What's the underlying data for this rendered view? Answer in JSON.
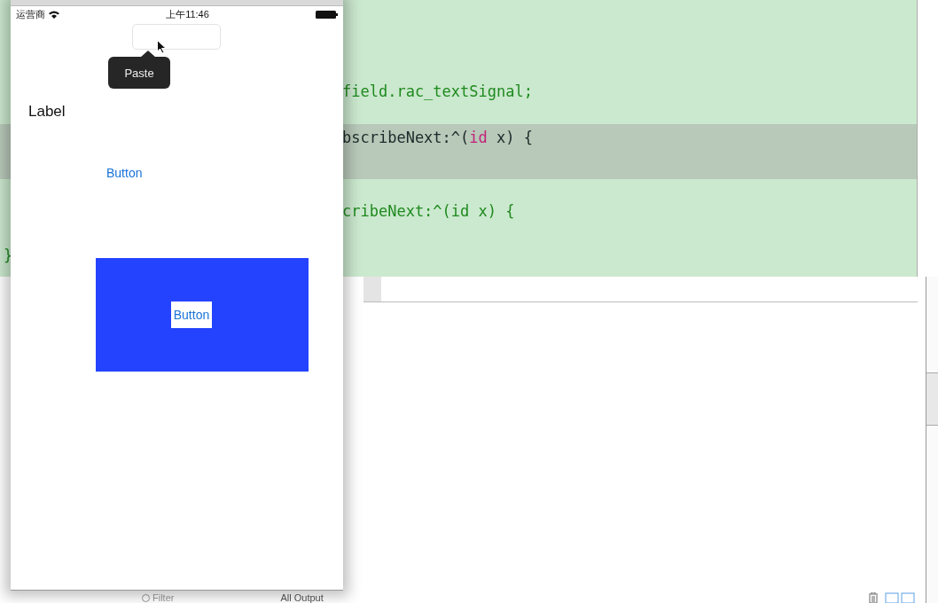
{
  "editor": {
    "gutter_text": "}",
    "code_lines": [
      {
        "highlighted": false,
        "parts": [
          {
            "text": "field.rac_textSignal;",
            "kind": "plain"
          }
        ]
      },
      {
        "highlighted": true,
        "parts": [
          {
            "text": "bscribeNext:^(",
            "kind": "plain"
          },
          {
            "text": "id",
            "kind": "keyword"
          },
          {
            "text": " x) {",
            "kind": "plain"
          }
        ]
      },
      {
        "highlighted": false,
        "parts": [
          {
            "text": "cribeNext:^(id x) {",
            "kind": "plain"
          }
        ]
      }
    ]
  },
  "simulator": {
    "status_bar": {
      "carrier": "运营商",
      "time": "上午11:46"
    },
    "edit_menu": {
      "items": [
        "Paste"
      ]
    },
    "label": "Label",
    "button": "Button",
    "panel_button": "Button"
  },
  "console": {
    "filter_placeholder": "Filter",
    "output_menu": "All Output"
  }
}
